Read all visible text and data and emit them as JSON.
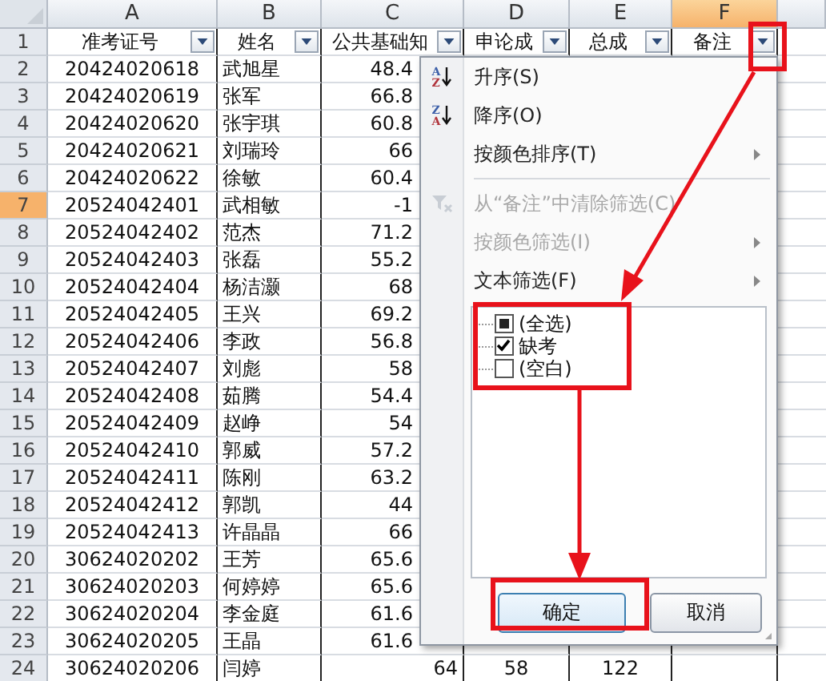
{
  "columns": [
    {
      "letter": "A",
      "header": "准考证号",
      "selected": false
    },
    {
      "letter": "B",
      "header": "姓名",
      "selected": false
    },
    {
      "letter": "C",
      "header": "公共基础知",
      "selected": false
    },
    {
      "letter": "D",
      "header": "申论成",
      "selected": false
    },
    {
      "letter": "E",
      "header": "总成",
      "selected": false
    },
    {
      "letter": "F",
      "header": "备注",
      "selected": true
    }
  ],
  "header_row": {
    "num": "1",
    "selected": false
  },
  "rows": [
    {
      "num": "2",
      "selected": false,
      "cells": [
        "20424020618",
        "武旭星",
        "48.4"
      ]
    },
    {
      "num": "3",
      "selected": false,
      "cells": [
        "20424020619",
        "张军",
        "66.8"
      ]
    },
    {
      "num": "4",
      "selected": false,
      "cells": [
        "20424020620",
        "张宇琪",
        "60.8"
      ]
    },
    {
      "num": "5",
      "selected": false,
      "cells": [
        "20424020621",
        "刘瑞玲",
        "66"
      ]
    },
    {
      "num": "6",
      "selected": false,
      "cells": [
        "20424020622",
        "徐敏",
        "60.4"
      ]
    },
    {
      "num": "7",
      "selected": true,
      "cells": [
        "20524042401",
        "武相敏",
        "-1"
      ]
    },
    {
      "num": "8",
      "selected": false,
      "cells": [
        "20524042402",
        "范杰",
        "71.2"
      ]
    },
    {
      "num": "9",
      "selected": false,
      "cells": [
        "20524042403",
        "张磊",
        "55.2"
      ]
    },
    {
      "num": "10",
      "selected": false,
      "cells": [
        "20524042404",
        "杨洁灏",
        "68"
      ]
    },
    {
      "num": "11",
      "selected": false,
      "cells": [
        "20524042405",
        "王兴",
        "69.2"
      ]
    },
    {
      "num": "12",
      "selected": false,
      "cells": [
        "20524042406",
        "李政",
        "56.8"
      ]
    },
    {
      "num": "13",
      "selected": false,
      "cells": [
        "20524042407",
        "刘彪",
        "58"
      ]
    },
    {
      "num": "14",
      "selected": false,
      "cells": [
        "20524042408",
        "茹腾",
        "54.4"
      ]
    },
    {
      "num": "15",
      "selected": false,
      "cells": [
        "20524042409",
        "赵峥",
        "54"
      ]
    },
    {
      "num": "16",
      "selected": false,
      "cells": [
        "20524042410",
        "郭威",
        "57.2"
      ]
    },
    {
      "num": "17",
      "selected": false,
      "cells": [
        "20524042411",
        "陈刚",
        "63.2"
      ]
    },
    {
      "num": "18",
      "selected": false,
      "cells": [
        "20524042412",
        "郭凯",
        "44"
      ]
    },
    {
      "num": "19",
      "selected": false,
      "cells": [
        "20524042413",
        "许晶晶",
        "66"
      ]
    },
    {
      "num": "20",
      "selected": false,
      "cells": [
        "30624020202",
        "王芳",
        "65.6"
      ]
    },
    {
      "num": "21",
      "selected": false,
      "cells": [
        "30624020203",
        "何婷婷",
        "65.6"
      ]
    },
    {
      "num": "22",
      "selected": false,
      "cells": [
        "30624020204",
        "李金庭",
        "61.6"
      ]
    },
    {
      "num": "23",
      "selected": false,
      "cells": [
        "30624020205",
        "王晶",
        "61.6"
      ]
    },
    {
      "num": "24",
      "selected": false,
      "cells": [
        "30624020206",
        "闫婷",
        "64",
        "58",
        "122"
      ]
    }
  ],
  "filter_menu": {
    "items": [
      {
        "kind": "sort",
        "icon_letters": [
          "A",
          "Z"
        ],
        "label": "升序(S)",
        "disabled": false,
        "submenu": false
      },
      {
        "kind": "sort",
        "icon_letters": [
          "Z",
          "A"
        ],
        "label": "降序(O)",
        "disabled": false,
        "submenu": false
      },
      {
        "kind": "plain",
        "label": "按颜色排序(T)",
        "disabled": false,
        "submenu": true
      },
      {
        "kind": "separator"
      },
      {
        "kind": "clear",
        "label": "从“备注”中清除筛选(C)",
        "disabled": true,
        "submenu": false
      },
      {
        "kind": "plain",
        "label": "按颜色筛选(I)",
        "disabled": true,
        "submenu": true
      },
      {
        "kind": "plain",
        "label": "文本筛选(F)",
        "disabled": false,
        "submenu": true
      }
    ],
    "values": [
      {
        "label": "(全选)",
        "checked": false,
        "partial": true
      },
      {
        "label": "缺考",
        "checked": true,
        "partial": false
      },
      {
        "label": "(空白)",
        "checked": false,
        "partial": false
      }
    ],
    "buttons": [
      {
        "label": "确定",
        "selected": true
      },
      {
        "label": "取消",
        "selected": false
      }
    ]
  }
}
